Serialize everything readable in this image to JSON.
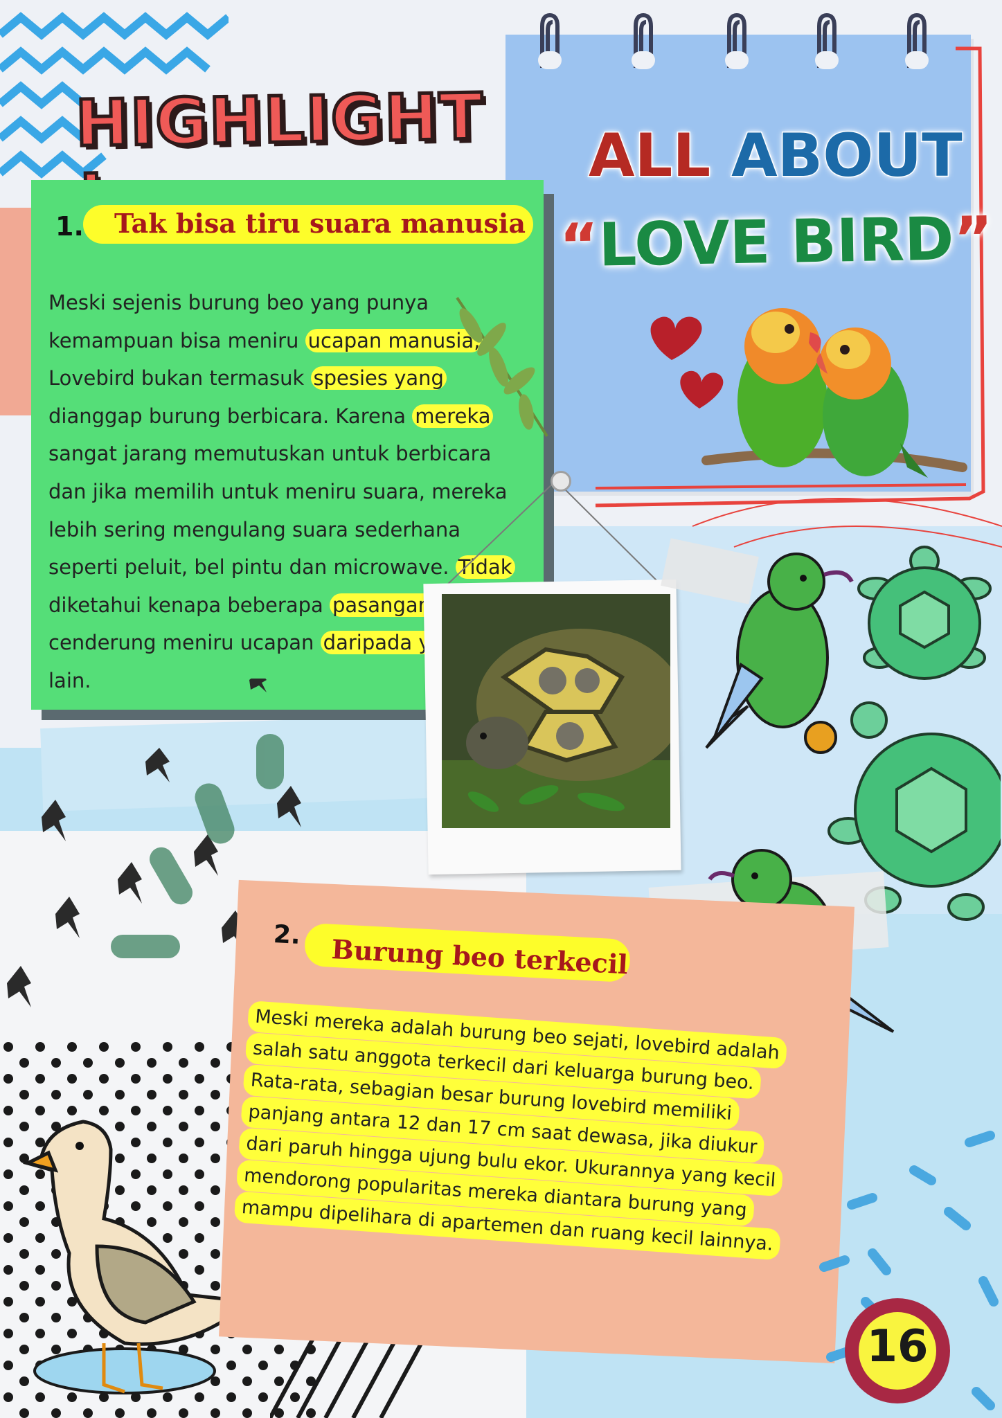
{
  "header": {
    "highlight_title": "HIGHLIGHT !"
  },
  "notebook": {
    "title_word_1": "ALL",
    "title_word_2": "ABOUT",
    "title_quote_open": "“",
    "title_main": "LOVE BIRD",
    "title_quote_close": "”"
  },
  "section_1": {
    "number": "1.",
    "heading": "Tak bisa tiru suara manusia",
    "body": [
      {
        "text": "Meski sejenis burung beo yang punya",
        "hl": false
      },
      {
        "text": "kemampuan bisa meniru ",
        "hl": false
      },
      {
        "text": "ucapan manusia,",
        "hl": true
      },
      {
        "text": "Lovebird bukan termasuk ",
        "hl": false
      },
      {
        "text": "spesies yang",
        "hl": true
      },
      {
        "text": "dianggap burung berbicara. Karena ",
        "hl": false
      },
      {
        "text": "mereka",
        "hl": true
      },
      {
        "text": "sangat jarang memutuskan untuk berbicara",
        "hl": false
      },
      {
        "text": "dan jika memilih untuk meniru suara, mereka",
        "hl": false
      },
      {
        "text": "lebih sering mengulang suara sederhana",
        "hl": false
      },
      {
        "text": "seperti peluit, bel pintu dan microwave. ",
        "hl": false
      },
      {
        "text": "Tidak",
        "hl": true
      },
      {
        "text": "diketahui kenapa beberapa ",
        "hl": false
      },
      {
        "text": "pasangan lebih",
        "hl": true
      },
      {
        "text": "cenderung meniru ucapan ",
        "hl": false
      },
      {
        "text": "daripada yang",
        "hl": true
      },
      {
        "text": "lain.",
        "hl": false
      }
    ]
  },
  "section_2": {
    "number": "2.",
    "heading": "Burung beo terkecil",
    "lines": [
      "Meski mereka adalah burung beo sejati, lovebird adalah",
      "salah satu anggota terkecil dari keluarga burung beo.",
      "Rata-rata, sebagian besar burung lovebird memiliki",
      "panjang antara 12 dan 17 cm saat dewasa, jika diukur",
      "dari paruh hingga ujung bulu ekor. Ukurannya yang kecil",
      "mendorong popularitas mereka diantara burung yang",
      "mampu dipelihara di apartemen dan ruang kecil lainnya."
    ]
  },
  "footer": {
    "page_number": "16"
  },
  "colors": {
    "card_green": "#55de78",
    "card_orange": "#f4b79a",
    "highlight_yellow": "#ffff3a",
    "heading_red": "#a6181c",
    "notebook_blue": "#9cc3f0"
  },
  "icons": [
    "zigzag-decoration",
    "spiral-ring-icon",
    "heart-icon",
    "lovebird-illustration",
    "leaf-icon",
    "tortoise-photo",
    "green-bird-sticker",
    "turtle-sticker",
    "bird-flock",
    "duck-sticker",
    "pin-icon"
  ]
}
